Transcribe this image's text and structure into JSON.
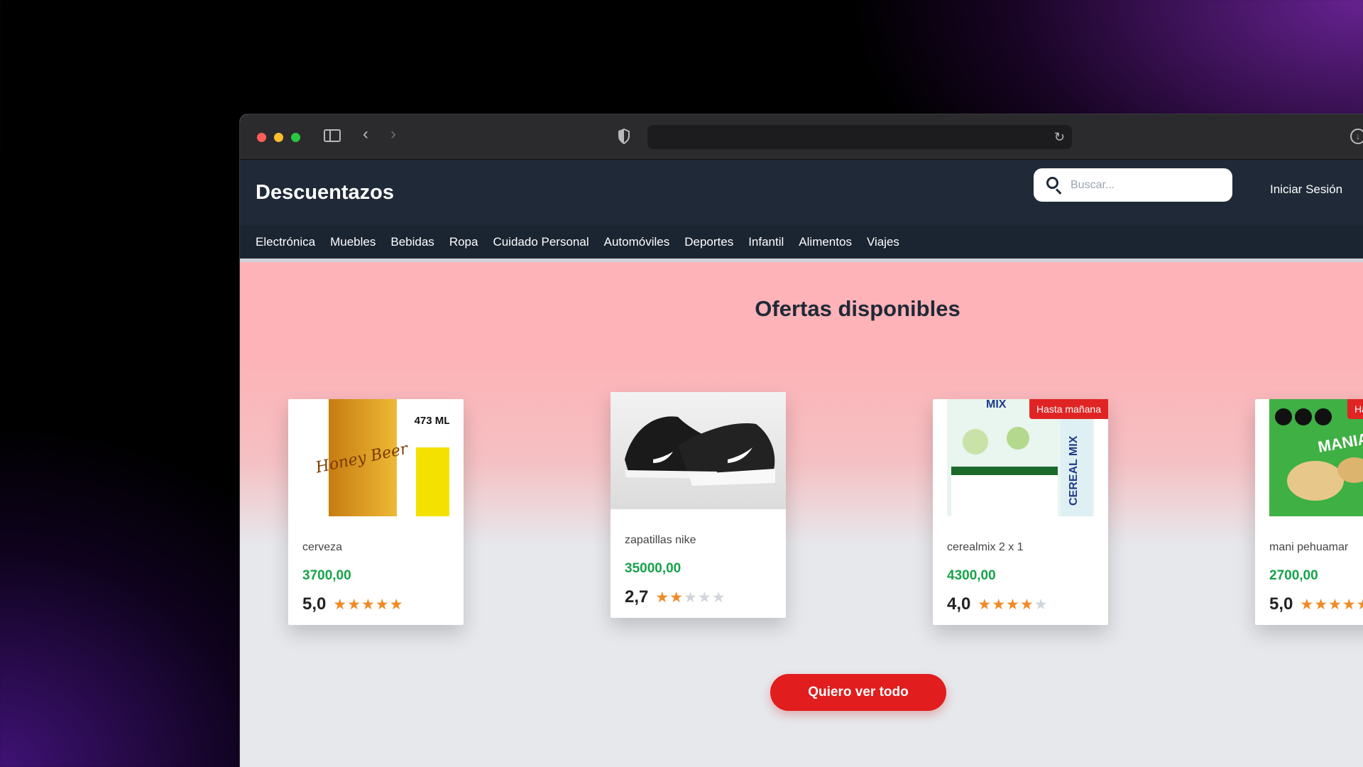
{
  "browser": {
    "url": ""
  },
  "site": {
    "logo": "Descuentazos",
    "login": "Iniciar Sesión"
  },
  "search": {
    "placeholder": "Buscar..."
  },
  "nav": {
    "items": [
      "Electrónica",
      "Muebles",
      "Bebidas",
      "Ropa",
      "Cuidado Personal",
      "Automóviles",
      "Deportes",
      "Infantil",
      "Alimentos",
      "Viajes"
    ]
  },
  "offers": {
    "title": "Ofertas disponibles",
    "products": [
      {
        "name": "cerveza",
        "price": "3700,00",
        "rating": "5,0",
        "stars": 5,
        "badge": "",
        "img_text": "Honey Beer",
        "img_text2": "473 ML"
      },
      {
        "name": "zapatillas nike",
        "price": "35000,00",
        "rating": "2,7",
        "stars": 2,
        "badge": "",
        "img_text": "",
        "img_text2": ""
      },
      {
        "name": "cerealmix 2 x 1",
        "price": "4300,00",
        "rating": "4,0",
        "stars": 4,
        "badge": "Hasta mañana",
        "img_text": "CEREAL MIX",
        "img_text2": "MIX"
      },
      {
        "name": "mani pehuamar",
        "price": "2700,00",
        "rating": "5,0",
        "stars": 5,
        "badge": "Ha",
        "img_text": "MANIAX",
        "img_text2": ""
      }
    ],
    "cta": "Quiero ver todo"
  },
  "colors": {
    "accent": "#e11d1d",
    "price": "#16a34a",
    "star": "#f08a24",
    "header": "#1f2937"
  }
}
